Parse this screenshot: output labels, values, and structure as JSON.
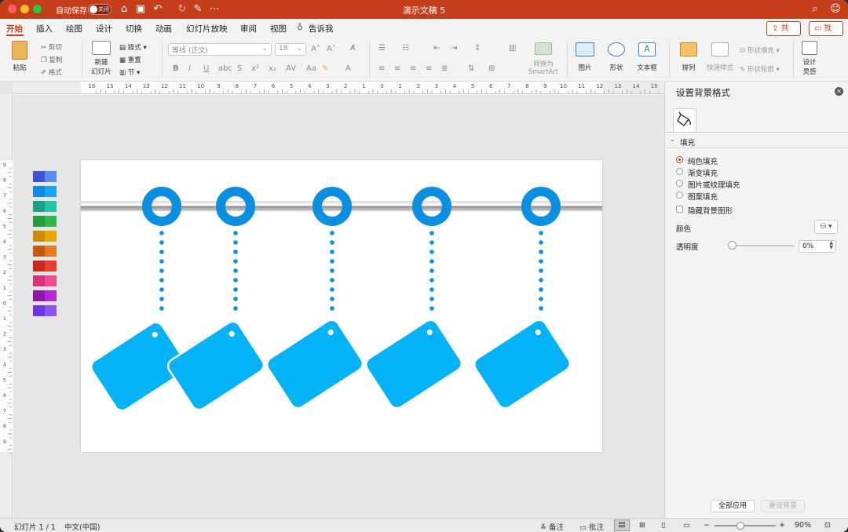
{
  "app": {
    "autosave_label": "自动保存",
    "autosave_state": "关闭",
    "doc_title": "演示文稿 5"
  },
  "tabs": [
    "开始",
    "插入",
    "绘图",
    "设计",
    "切换",
    "动画",
    "幻灯片放映",
    "审阅",
    "视图",
    "告诉我"
  ],
  "active_tab": "开始",
  "share_label": "共享",
  "comment_label": "批注",
  "ribbon": {
    "paste": "粘贴",
    "cut": "剪切",
    "copy": "复制",
    "format": "格式",
    "new_slide_1": "新建",
    "new_slide_2": "幻灯片",
    "layout": "版式",
    "reset": "重置",
    "section": "节",
    "font_name": "等线 (正文)",
    "font_size": "18",
    "convert_1": "转换为",
    "convert_2": "SmartArt",
    "picture": "图片",
    "shape": "形状",
    "textbox": "文本框",
    "arrange": "排列",
    "quick_styles": "快速样式",
    "shape_fill": "形状填充",
    "shape_outline": "形状轮廓",
    "designer_1": "设计",
    "designer_2": "灵感"
  },
  "ruler_h_labels": [
    "16",
    "15",
    "14",
    "13",
    "12",
    "11",
    "10",
    "9",
    "8",
    "7",
    "6",
    "5",
    "4",
    "3",
    "2",
    "1",
    "0",
    "1",
    "2",
    "3",
    "4",
    "5",
    "6",
    "7",
    "8",
    "9",
    "10",
    "11",
    "12",
    "13",
    "14",
    "15",
    "16"
  ],
  "ruler_v_labels": [
    "9",
    "8",
    "7",
    "6",
    "5",
    "4",
    "3",
    "2",
    "1",
    "0",
    "1",
    "2",
    "3",
    "4",
    "5",
    "6",
    "7",
    "8",
    "9"
  ],
  "palette_colors": [
    [
      "#3f51d6",
      "#5b8cf5"
    ],
    [
      "#1089e6",
      "#17a7f5"
    ],
    [
      "#1a9e86",
      "#22c4a5"
    ],
    [
      "#259c3b",
      "#35b64a"
    ],
    [
      "#c98e00",
      "#e8a600"
    ],
    [
      "#c05a0e",
      "#e47920"
    ],
    [
      "#c9281f",
      "#ea3f33"
    ],
    [
      "#d3357a",
      "#f24b92"
    ],
    [
      "#8e1aa3",
      "#b42bd0"
    ],
    [
      "#6d35e0",
      "#8a57f3"
    ]
  ],
  "slide": {
    "ring_color": "#0b8fe0",
    "tag_color": "#05b2f6",
    "rod_color": "#a8a8a8"
  },
  "pane": {
    "title": "设置背景格式",
    "section": "填充",
    "options": [
      "纯色填充",
      "渐变填充",
      "图片或纹理填充",
      "图案填充"
    ],
    "selected_option": "纯色填充",
    "hide_bg": "隐藏背景图形",
    "color_label": "颜色",
    "transparency_label": "透明度",
    "transparency_value": "0%",
    "apply_all": "全部应用",
    "reset_bg": "重设背景"
  },
  "status": {
    "slide_info": "幻灯片 1 / 1",
    "language": "中文(中国)",
    "notes": "备注",
    "comments": "批注",
    "zoom": "90%"
  },
  "accent_color": "#c43e1c"
}
